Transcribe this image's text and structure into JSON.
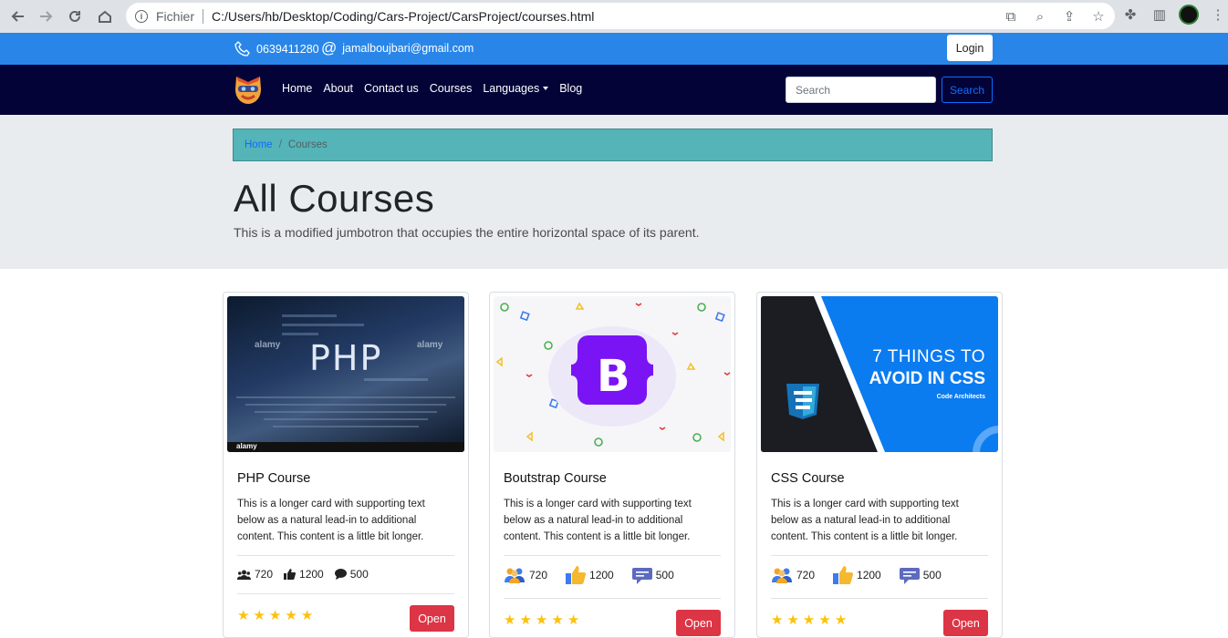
{
  "browser": {
    "scheme_label": "Fichier",
    "url": "C:/Users/hb/Desktop/Coding/Cars-Project/CarsProject/courses.html"
  },
  "topbar": {
    "phone": "0639411280",
    "email": "jamalboujbari@gmail.com",
    "login_label": "Login",
    "background": "#2986e8"
  },
  "navbar": {
    "links": [
      "Home",
      "About",
      "Contact us",
      "Courses",
      "Languages",
      "Blog"
    ],
    "search_placeholder": "Search",
    "search_button": "Search",
    "background": "#030338"
  },
  "breadcrumb": {
    "home": "Home",
    "separator": "/",
    "current": "Courses"
  },
  "jumbotron": {
    "title": "All Courses",
    "lead": "This is a modified jumbotron that occupies the entire horizontal space of its parent."
  },
  "cards": [
    {
      "title": "PHP Course",
      "text": "This is a longer card with supporting text below as a natural lead-in to additional content. This content is a little bit longer.",
      "image_text": "PHP",
      "watermark": "alamy",
      "users": "720",
      "likes": "1200",
      "comments": "500",
      "stars": 5,
      "open_label": "Open"
    },
    {
      "title": "Boutstrap Course",
      "text": "This is a longer card with supporting text below as a natural lead-in to additional content. This content is a little bit longer.",
      "image_text": "B",
      "users": "720",
      "likes": "1200",
      "comments": "500",
      "stars": 5,
      "open_label": "Open"
    },
    {
      "title": "CSS Course",
      "text": "This is a longer card with supporting text below as a natural lead-in to additional content. This content is a little bit longer.",
      "image_line1": "7 THINGS TO",
      "image_line2": "AVOID IN CSS",
      "image_line3": "Code Architects",
      "users": "720",
      "likes": "1200",
      "comments": "500",
      "stars": 5,
      "open_label": "Open"
    }
  ],
  "colors": {
    "accent_red": "#dc3545",
    "star": "#ffc107",
    "breadcrumb_bg": "#54b4b8"
  }
}
